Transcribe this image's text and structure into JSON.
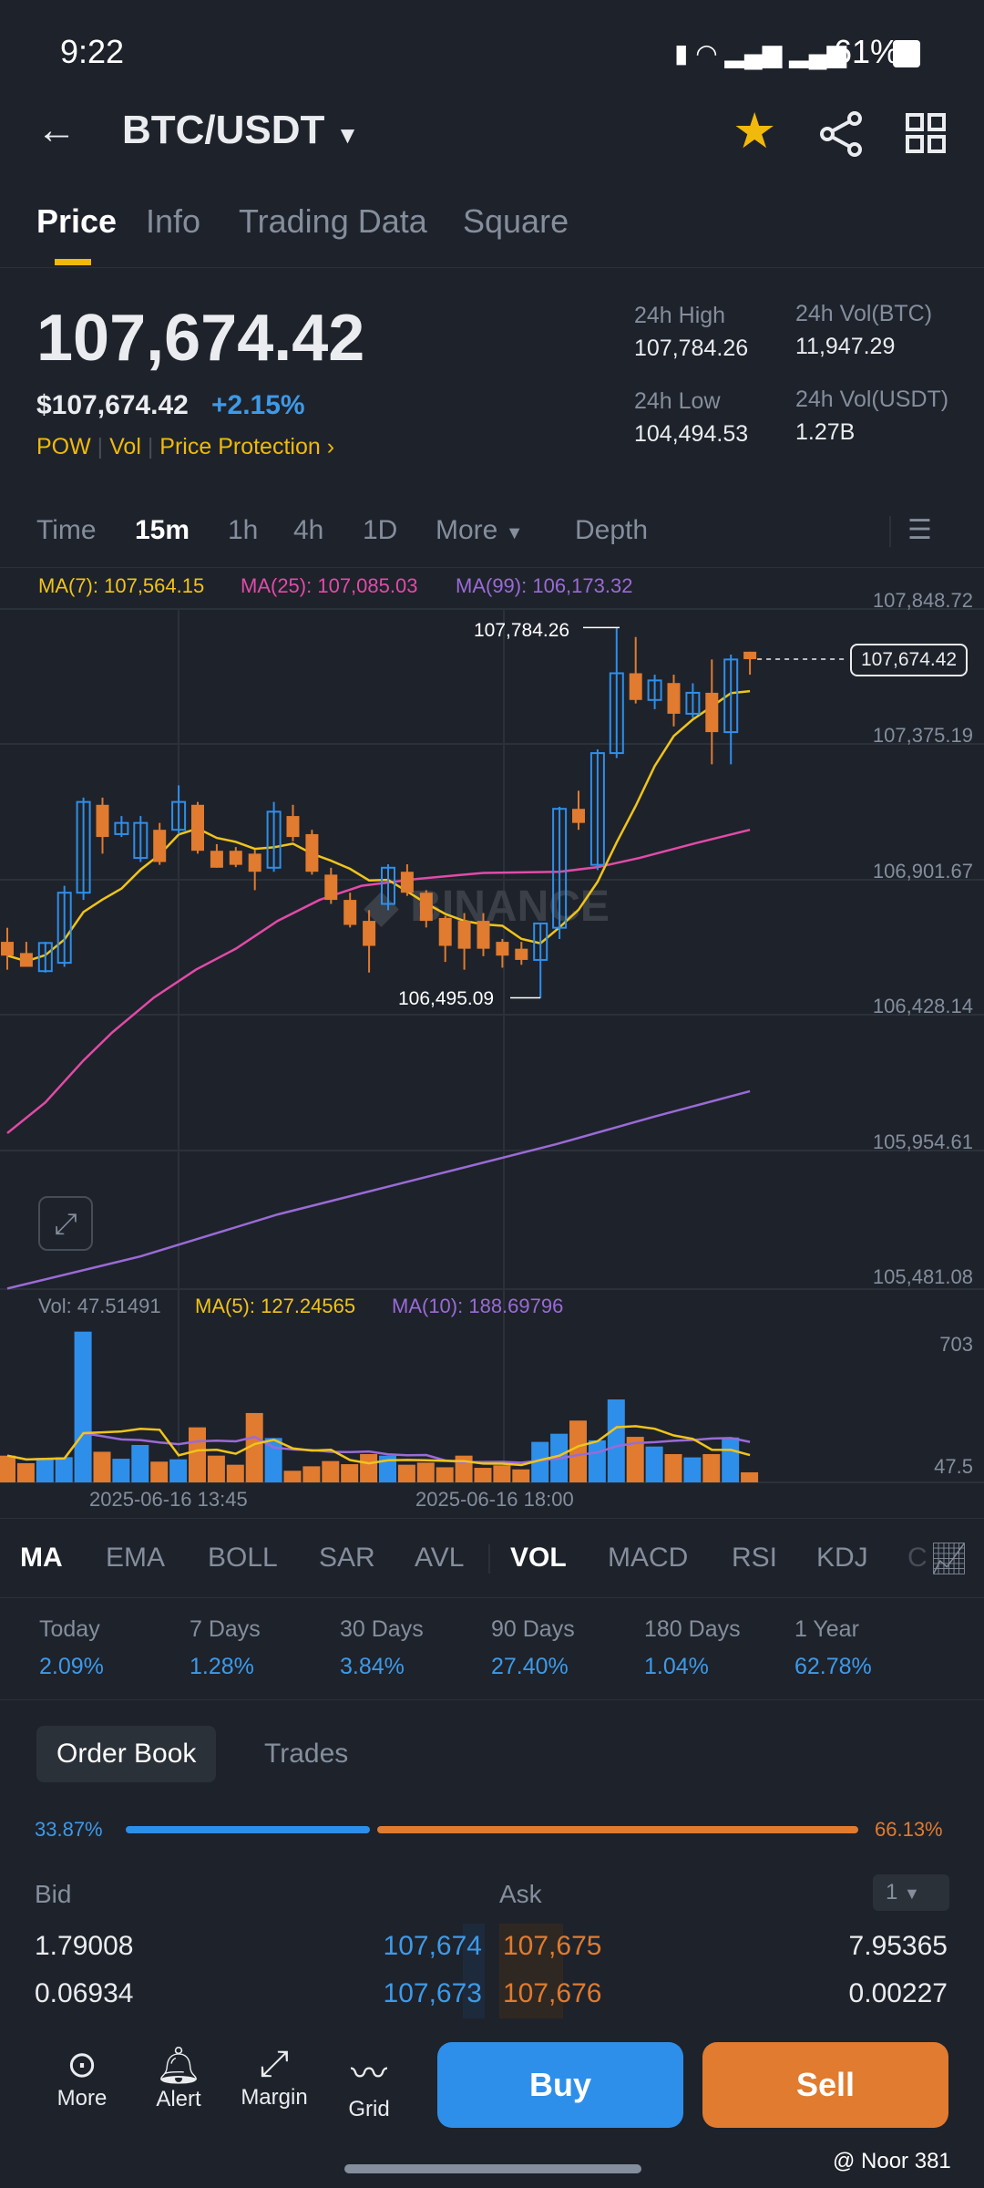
{
  "status": {
    "time": "9:22",
    "battery": "61%"
  },
  "header": {
    "pair": "BTC/USDT"
  },
  "tabs": [
    "Price",
    "Info",
    "Trading Data",
    "Square"
  ],
  "ticker": {
    "price": "107,674.42",
    "usd": "$107,674.42",
    "change": "+2.15%",
    "tags": [
      "POW",
      "Vol",
      "Price Protection"
    ],
    "high_label": "24h High",
    "high": "107,784.26",
    "low_label": "24h Low",
    "low": "104,494.53",
    "volbtc_label": "24h Vol(BTC)",
    "volbtc": "11,947.29",
    "volusdt_label": "24h Vol(USDT)",
    "volusdt": "1.27B"
  },
  "timeframes": [
    "Time",
    "15m",
    "1h",
    "4h",
    "1D",
    "More",
    "Depth"
  ],
  "ma_legend": {
    "ma7": "MA(7): 107,564.15",
    "ma25": "MA(25): 107,085.03",
    "ma99": "MA(99): 106,173.32"
  },
  "price_axis": [
    "107,848.72",
    "107,375.19",
    "106,901.67",
    "106,428.14",
    "105,954.61",
    "105,481.08"
  ],
  "annotations": {
    "high": "107,784.26",
    "low": "106,495.09",
    "current": "107,674.42"
  },
  "vol_legend": {
    "vol": "Vol: 47.51491",
    "ma5": "MA(5): 127.24565",
    "ma10": "MA(10): 188.69796"
  },
  "vol_axis": [
    "703",
    "47.5"
  ],
  "dates": [
    "2025-06-16 13:45",
    "2025-06-16 18:00"
  ],
  "indicators": [
    "MA",
    "EMA",
    "BOLL",
    "SAR",
    "AVL",
    "VOL",
    "MACD",
    "RSI",
    "KDJ",
    "C"
  ],
  "performance": [
    {
      "l": "Today",
      "v": "2.09%"
    },
    {
      "l": "7 Days",
      "v": "1.28%"
    },
    {
      "l": "30 Days",
      "v": "3.84%"
    },
    {
      "l": "90 Days",
      "v": "27.40%"
    },
    {
      "l": "180 Days",
      "v": "1.04%"
    },
    {
      "l": "1 Year",
      "v": "62.78%"
    }
  ],
  "orderbook": {
    "tabs": [
      "Order Book",
      "Trades"
    ],
    "bid_pct": "33.87%",
    "ask_pct": "66.13%",
    "bid_ratio": 0.3387,
    "bid": "Bid",
    "ask": "Ask",
    "precision": "1",
    "rows": [
      {
        "bq": "1.79008",
        "bp": "107,674",
        "ap": "107,675",
        "aq": "7.95365"
      },
      {
        "bq": "0.06934",
        "bp": "107,673",
        "ap": "107,676",
        "aq": "0.00227"
      }
    ]
  },
  "bottom": {
    "more": "More",
    "alert": "Alert",
    "margin": "Margin",
    "grid": "Grid",
    "buy": "Buy",
    "sell": "Sell"
  },
  "watermark": "@ Noor 381",
  "colors": {
    "up": "#2e8fea",
    "down": "#e07b2f",
    "ma7": "#f0c419",
    "ma25": "#e24ba8",
    "ma99": "#9a6bd6",
    "accent": "#f0b90b"
  },
  "chart_data": {
    "type": "candlestick",
    "ylim": [
      105481.08,
      107848.72
    ],
    "ohlc": [
      [
        106690,
        106739,
        106593,
        106642
      ],
      [
        106651,
        106690,
        106617,
        106603
      ],
      [
        106588,
        106690,
        106583,
        106686
      ],
      [
        106617,
        106885,
        106603,
        106861
      ],
      [
        106861,
        107192,
        106836,
        107177
      ],
      [
        107167,
        107192,
        106997,
        107055
      ],
      [
        107065,
        107128,
        107055,
        107104
      ],
      [
        106982,
        107128,
        106968,
        107104
      ],
      [
        107080,
        107104,
        106958,
        106968
      ],
      [
        107080,
        107235,
        107065,
        107177
      ],
      [
        107167,
        107177,
        106997,
        107007
      ],
      [
        107007,
        107030,
        106948,
        106948
      ],
      [
        107007,
        107020,
        106950,
        106958
      ],
      [
        106997,
        107010,
        106870,
        106934
      ],
      [
        106948,
        107177,
        106934,
        107143
      ],
      [
        107128,
        107167,
        107040,
        107055
      ],
      [
        107065,
        107080,
        106924,
        106934
      ],
      [
        106924,
        106948,
        106822,
        106836
      ],
      [
        106836,
        106861,
        106740,
        106749
      ],
      [
        106763,
        106800,
        106583,
        106676
      ],
      [
        106822,
        106960,
        106800,
        106948
      ],
      [
        106934,
        106960,
        106850,
        106861
      ],
      [
        106861,
        106870,
        106740,
        106763
      ],
      [
        106773,
        106780,
        106620,
        106676
      ],
      [
        106763,
        106790,
        106593,
        106666
      ],
      [
        106763,
        106790,
        106640,
        106666
      ],
      [
        106690,
        106700,
        106600,
        106642
      ],
      [
        106666,
        106690,
        106610,
        106627
      ],
      [
        106627,
        106754,
        106495,
        106754
      ],
      [
        106739,
        107160,
        106700,
        107153
      ],
      [
        107153,
        107216,
        107080,
        107104
      ],
      [
        106958,
        107360,
        106940,
        107347
      ],
      [
        107347,
        107784,
        107330,
        107625
      ],
      [
        107625,
        107751,
        107520,
        107532
      ],
      [
        107532,
        107620,
        107500,
        107600
      ],
      [
        107591,
        107620,
        107440,
        107484
      ],
      [
        107484,
        107590,
        107470,
        107557
      ],
      [
        107557,
        107673,
        107308,
        107420
      ],
      [
        107420,
        107690,
        107308,
        107673
      ],
      [
        107700,
        107700,
        107620,
        107674
      ]
    ],
    "ma25": [
      [
        0,
        106024
      ],
      [
        2,
        106131
      ],
      [
        4,
        106277
      ],
      [
        5.5,
        106374
      ],
      [
        7.7,
        106496
      ],
      [
        9.9,
        106593
      ],
      [
        12,
        106666
      ],
      [
        14.2,
        106763
      ],
      [
        16.4,
        106836
      ],
      [
        18.6,
        106885
      ],
      [
        21.5,
        106909
      ],
      [
        25,
        106930
      ],
      [
        29,
        106934
      ],
      [
        31,
        106950
      ],
      [
        33.2,
        106982
      ],
      [
        36,
        107031
      ],
      [
        39,
        107080
      ]
    ],
    "ma99": [
      [
        0,
        105483
      ],
      [
        7,
        105595
      ],
      [
        14.2,
        105741
      ],
      [
        21.5,
        105863
      ],
      [
        28.8,
        105985
      ],
      [
        34,
        106082
      ],
      [
        39,
        106170
      ]
    ],
    "volume": [
      138,
      99,
      126,
      130,
      778,
      158,
      122,
      193,
      107,
      119,
      284,
      138,
      91,
      358,
      229,
      60,
      83,
      110,
      94,
      146,
      138,
      91,
      102,
      78,
      138,
      75,
      88,
      67,
      209,
      251,
      319,
      217,
      428,
      235,
      185,
      146,
      129,
      146,
      232,
      52
    ]
  }
}
